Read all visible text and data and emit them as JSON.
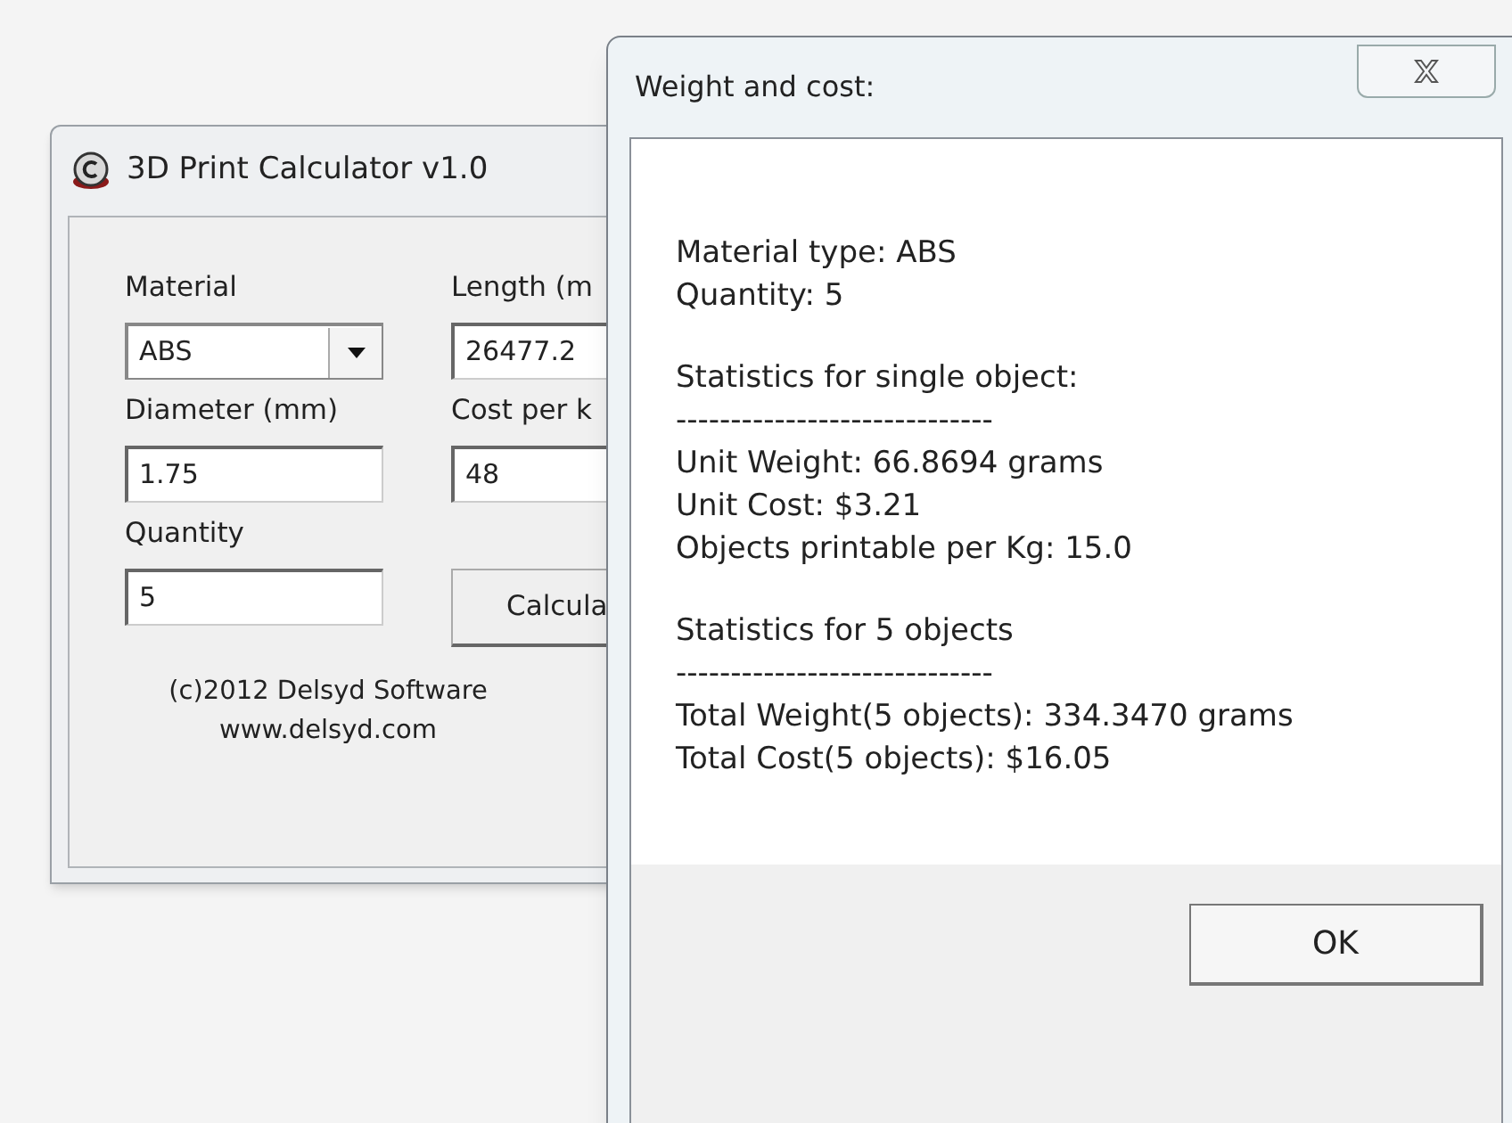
{
  "main_window": {
    "title": "3D Print Calculator v1.0",
    "left_column": [
      {
        "label": "Material",
        "kind": "dropdown",
        "value": "ABS"
      },
      {
        "label": "Diameter (mm)",
        "kind": "field",
        "value": "1.75"
      },
      {
        "label": "Quantity",
        "kind": "field",
        "value": "5"
      }
    ],
    "right_column": [
      {
        "label": "Length (m",
        "kind": "field",
        "value": "26477.2"
      },
      {
        "label": "Cost per k",
        "kind": "field",
        "value": "48"
      },
      {
        "kind": "button",
        "value": "Calcula"
      }
    ],
    "footer": [
      "(c)2012 Delsyd Software",
      "www.delsyd.com"
    ]
  },
  "dialog": {
    "title": "Weight and cost:",
    "groups": [
      [
        "Material type: ABS",
        "Quantity: 5"
      ],
      [
        "Statistics for single object:",
        "-----------------------------",
        "Unit Weight: 66.8694 grams",
        "Unit Cost: $3.21",
        "Objects printable per Kg: 15.0"
      ],
      [
        "Statistics for 5 objects",
        "-----------------------------",
        "Total Weight(5 objects): 334.3470 grams",
        "Total Cost(5 objects): $16.05"
      ]
    ],
    "button": "OK"
  }
}
